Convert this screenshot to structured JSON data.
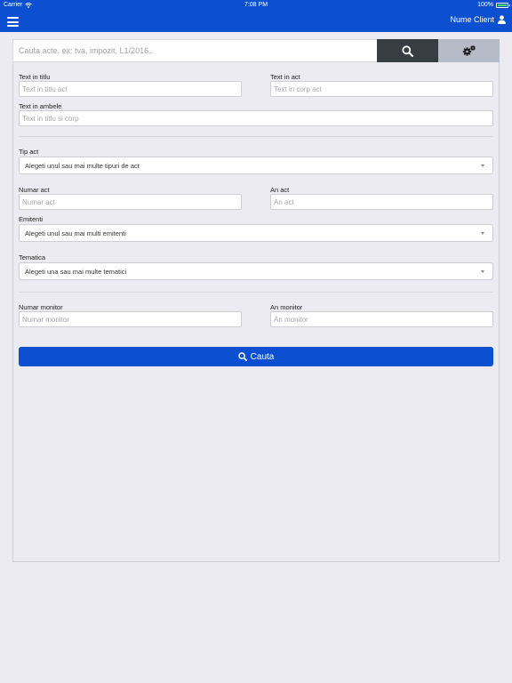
{
  "status_bar": {
    "carrier": "Carrier",
    "time": "7:08 PM",
    "battery": "100%"
  },
  "nav": {
    "client_name": "Nume Client"
  },
  "search": {
    "placeholder": "Cauta acte. ex: tva, impozit, L1/2016.."
  },
  "form": {
    "title_label": "Text in titlu",
    "title_placeholder": "Text in titlu act",
    "act_text_label": "Text in act",
    "act_text_placeholder": "Text in corp act",
    "both_label": "Text in ambele",
    "both_placeholder": "Text in titlu si corp",
    "type_label": "Tip act",
    "type_value": "Alegeti unul sau mai multe tipuri de act",
    "number_label": "Numar act",
    "number_placeholder": "Numar act",
    "year_label": "An act",
    "year_placeholder": "An act",
    "issuers_label": "Emitenti",
    "issuers_value": "Alegeti unul sau mai multi emitenti",
    "topic_label": "Tematica",
    "topic_value": "Alegeti una sau mai multe tematici",
    "monitor_number_label": "Numar monitor",
    "monitor_number_placeholder": "Numar monitor",
    "monitor_year_label": "An monitor",
    "monitor_year_placeholder": "An monitor",
    "submit_label": "Cauta"
  },
  "colors": {
    "accent": "#0c4fd0",
    "search_button": "#383d44",
    "settings_button": "#b7bac7",
    "background": "#ebebf1"
  },
  "icons": {
    "menu": "hamburger-menu-icon",
    "user": "user-icon",
    "search": "search-icon",
    "settings": "gears-icon",
    "wifi": "wifi-icon",
    "battery": "battery-icon"
  }
}
